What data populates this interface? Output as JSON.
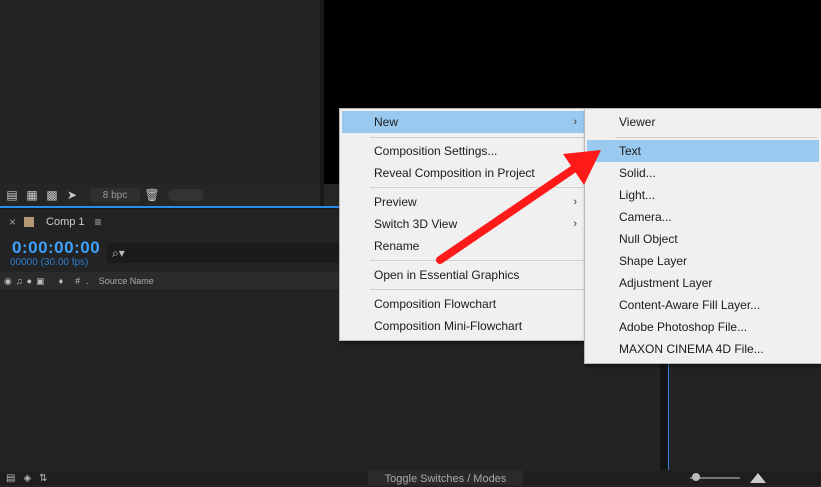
{
  "project_panel": {
    "bpc_label": "8 bpc"
  },
  "timeline": {
    "tab_name": "Comp 1",
    "timecode": "0:00:00:00",
    "frames": "00000 (30.00 fps)",
    "search_placeholder": "⌕▾",
    "hash_col": "#",
    "source_name_col": "Source Name",
    "toggle_label": "Toggle Switches / Modes"
  },
  "context_menu": {
    "items": [
      {
        "label": "New",
        "submenu": true,
        "highlighted": true
      },
      {
        "label": "Composition Settings..."
      },
      {
        "label": "Reveal Composition in Project"
      },
      {
        "label": "Preview",
        "submenu": true
      },
      {
        "label": "Switch 3D View",
        "submenu": true
      },
      {
        "label": "Rename"
      },
      {
        "label": "Open in Essential Graphics"
      },
      {
        "label": "Composition Flowchart"
      },
      {
        "label": "Composition Mini-Flowchart"
      }
    ]
  },
  "new_submenu": {
    "items": [
      {
        "label": "Viewer"
      },
      {
        "label": "Text",
        "highlighted": true
      },
      {
        "label": "Solid..."
      },
      {
        "label": "Light..."
      },
      {
        "label": "Camera..."
      },
      {
        "label": "Null Object"
      },
      {
        "label": "Shape Layer"
      },
      {
        "label": "Adjustment Layer"
      },
      {
        "label": "Content-Aware Fill Layer..."
      },
      {
        "label": "Adobe Photoshop File..."
      },
      {
        "label": "MAXON CINEMA 4D File..."
      }
    ]
  },
  "icons": {
    "submenu_arrow": "›"
  },
  "colors": {
    "highlight": "#99c9ef",
    "timecode": "#3ea1ff",
    "annotation_arrow": "#ff1a1a"
  }
}
